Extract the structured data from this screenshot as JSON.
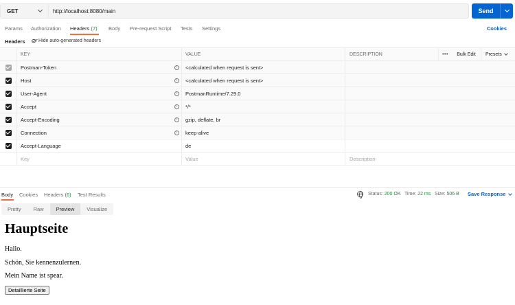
{
  "request": {
    "method": "GET",
    "url": "http://localhost:8080/main",
    "send_label": "Send"
  },
  "request_tabs": [
    {
      "label": "Params"
    },
    {
      "label": "Authorization"
    },
    {
      "label": "Headers",
      "count": "(7)"
    },
    {
      "label": "Body"
    },
    {
      "label": "Pre-request Script"
    },
    {
      "label": "Tests"
    },
    {
      "label": "Settings"
    }
  ],
  "cookies_link": "Cookies",
  "headers_section": {
    "label": "Headers",
    "hide_auto_label": "Hide auto-generated headers",
    "columns": {
      "key": "KEY",
      "value": "VALUE",
      "description": "DESCRIPTION",
      "more": "•••",
      "bulk_edit": "Bulk Edit",
      "presets": "Presets"
    },
    "rows": [
      {
        "key": "Postman-Token",
        "value": "<calculated when request is sent>",
        "auto": true,
        "disabled": true
      },
      {
        "key": "Host",
        "value": "<calculated when request is sent>",
        "auto": true
      },
      {
        "key": "User-Agent",
        "value": "PostmanRuntime/7.29.0",
        "auto": true
      },
      {
        "key": "Accept",
        "value": "*/*",
        "auto": true
      },
      {
        "key": "Accept-Encoding",
        "value": "gzip, deflate, br",
        "auto": true
      },
      {
        "key": "Connection",
        "value": "keep-alive",
        "auto": true
      },
      {
        "key": "Accept-Language",
        "value": "de",
        "auto": false
      }
    ],
    "placeholders": {
      "key": "Key",
      "value": "Value",
      "description": "Description"
    }
  },
  "response_tabs": [
    {
      "label": "Body"
    },
    {
      "label": "Cookies"
    },
    {
      "label": "Headers",
      "count": "(6)"
    },
    {
      "label": "Test Results"
    }
  ],
  "response_status": {
    "status_label": "Status:",
    "status_value": "200 OK",
    "time_label": "Time:",
    "time_value": "22 ms",
    "size_label": "Size:",
    "size_value": "506 B",
    "save_label": "Save Response"
  },
  "view_tabs": [
    "Pretty",
    "Raw",
    "Preview",
    "Visualize"
  ],
  "preview": {
    "title": "Hauptseite",
    "lines": [
      "Hallo.",
      "Schön, Sie kennenzulernen.",
      "Mein Name ist spear."
    ],
    "button_label": "Detaillierte Seite"
  },
  "colors": {
    "accent": "#f26b3a",
    "send": "#0265d2",
    "link": "#0b62c4",
    "success": "#1b8c3a"
  }
}
